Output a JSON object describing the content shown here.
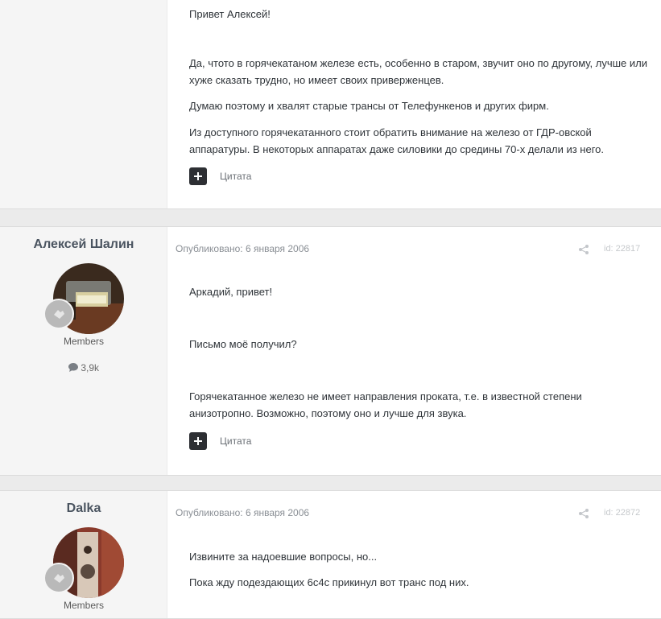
{
  "posts": [
    {
      "paragraphs": [
        "Привет Алексей!",
        "Да, чтото в горячекатаном железе есть, особенно в старом, звучит оно по другому, лучше или хуже сказать трудно, но имеет своих приверженцев.",
        "Думаю поэтому и хвалят старые трансы от Телефункенов и других фирм.",
        "Из доступного горячекатанного стоит обратить внимание на железо от ГДР-овской аппаратуры. В некоторых аппаратах даже силовики до средины 70-х делали из него."
      ],
      "quote_label": "Цитата"
    },
    {
      "author": "Алексей Шалин",
      "group": "Members",
      "post_count": "3,9k",
      "date": "Опубликовано: 6 января 2006",
      "id_label": "id: 22817",
      "paragraphs": [
        "Аркадий, привет!",
        "Письмо моё получил?",
        "Горячекатанное железо не имеет направления проката, т.е. в известной степени анизотропно. Возможно, поэтому оно и лучше для звука."
      ],
      "quote_label": "Цитата"
    },
    {
      "author": "Dalka",
      "group": "Members",
      "date": "Опубликовано: 6 января 2006",
      "id_label": "id: 22872",
      "paragraphs": [
        "Извините за надоевшие вопросы, но...",
        "Пока жду подездающих 6с4с прикинул вот транс под них."
      ]
    }
  ],
  "icons": {
    "share": "share-icon",
    "comment": "comment-icon",
    "plus": "plus-icon",
    "rank": "rank-badge-icon"
  },
  "colors": {
    "page_bg": "#ebebeb",
    "post_bg": "#ffffff",
    "author_bg": "#f5f5f5",
    "quote_button": "#2d2f33"
  }
}
